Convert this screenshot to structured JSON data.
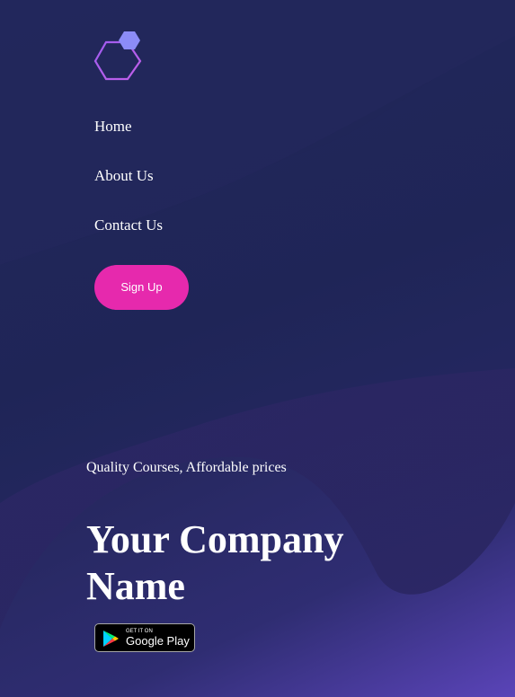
{
  "brand": {
    "logo_icon": "hexagon-logo-icon",
    "colors": {
      "hex_outline_start": "#a05cf0",
      "hex_outline_end": "#c15fe9",
      "hex_small": "#8c8cf7"
    }
  },
  "nav": {
    "items": [
      {
        "label": "Home"
      },
      {
        "label": "About Us"
      },
      {
        "label": "Contact Us"
      }
    ],
    "signup_label": "Sign Up"
  },
  "hero": {
    "tagline": "Quality Courses, Affordable prices",
    "company_name": "Your Company Name"
  },
  "store_badge": {
    "icon": "google-play-icon",
    "small_text": "GET IT ON",
    "large_text": "Google Play"
  },
  "colors": {
    "background": "#1f2557",
    "accent_button": "#e629ad",
    "text": "#ffffff"
  }
}
